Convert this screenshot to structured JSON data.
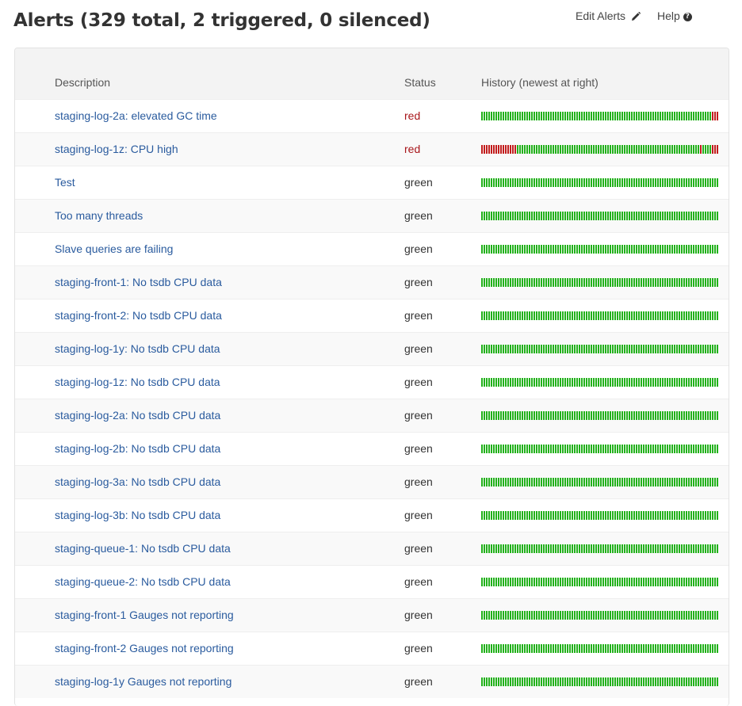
{
  "header": {
    "title": "Alerts (329 total, 2 triggered, 0 silenced)",
    "edit_label": "Edit Alerts",
    "help_label": "Help",
    "edit_icon": "pencil-icon",
    "help_icon": "question-circle-icon"
  },
  "table": {
    "columns": {
      "description": "Description",
      "status": "Status",
      "history": "History (newest at right)"
    },
    "history_slots": 100,
    "colors": {
      "green": "#22b11b",
      "red": "#c21d1d",
      "link": "#2a5b9e",
      "status_red": "#a8161b"
    },
    "rows": [
      {
        "description": "staging-log-2a: elevated GC time",
        "status": "red",
        "red_slots": [
          97,
          98,
          99
        ]
      },
      {
        "description": "staging-log-1z: CPU high",
        "status": "red",
        "red_slots": [
          0,
          1,
          2,
          3,
          4,
          5,
          6,
          7,
          8,
          9,
          10,
          11,
          12,
          13,
          14,
          92,
          97,
          98,
          99
        ]
      },
      {
        "description": "Test",
        "status": "green",
        "red_slots": []
      },
      {
        "description": "Too many threads",
        "status": "green",
        "red_slots": []
      },
      {
        "description": "Slave queries are failing",
        "status": "green",
        "red_slots": []
      },
      {
        "description": "staging-front-1: No tsdb CPU data",
        "status": "green",
        "red_slots": []
      },
      {
        "description": "staging-front-2: No tsdb CPU data",
        "status": "green",
        "red_slots": []
      },
      {
        "description": "staging-log-1y: No tsdb CPU data",
        "status": "green",
        "red_slots": []
      },
      {
        "description": "staging-log-1z: No tsdb CPU data",
        "status": "green",
        "red_slots": []
      },
      {
        "description": "staging-log-2a: No tsdb CPU data",
        "status": "green",
        "red_slots": []
      },
      {
        "description": "staging-log-2b: No tsdb CPU data",
        "status": "green",
        "red_slots": []
      },
      {
        "description": "staging-log-3a: No tsdb CPU data",
        "status": "green",
        "red_slots": []
      },
      {
        "description": "staging-log-3b: No tsdb CPU data",
        "status": "green",
        "red_slots": []
      },
      {
        "description": "staging-queue-1: No tsdb CPU data",
        "status": "green",
        "red_slots": []
      },
      {
        "description": "staging-queue-2: No tsdb CPU data",
        "status": "green",
        "red_slots": []
      },
      {
        "description": "staging-front-1 Gauges not reporting",
        "status": "green",
        "red_slots": []
      },
      {
        "description": "staging-front-2 Gauges not reporting",
        "status": "green",
        "red_slots": []
      },
      {
        "description": "staging-log-1y Gauges not reporting",
        "status": "green",
        "red_slots": []
      }
    ]
  }
}
